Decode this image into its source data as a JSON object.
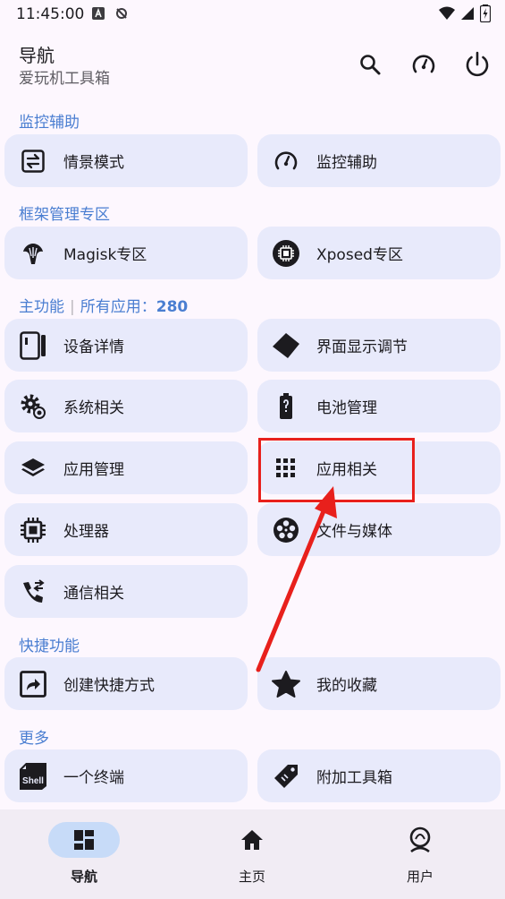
{
  "status_bar": {
    "time": "11:45:00",
    "icons": [
      "a-letter-icon",
      "no-sync-icon",
      "wifi-icon",
      "signal-icon",
      "battery-charging-icon"
    ]
  },
  "header": {
    "title": "导航",
    "subtitle": "爱玩机工具箱",
    "actions": [
      "search-icon",
      "speedometer-icon",
      "power-icon"
    ]
  },
  "sections": {
    "monitor": {
      "label": "监控辅助"
    },
    "framework": {
      "label": "框架管理专区"
    },
    "main": {
      "label": "主功能",
      "apps_label": "所有应用：",
      "apps_count": "280"
    },
    "shortcut": {
      "label": "快捷功能"
    },
    "more": {
      "label": "更多"
    }
  },
  "cards": {
    "scene_mode": "情景模式",
    "monitor_assist": "监控辅助",
    "magisk": "Magisk专区",
    "xposed": "Xposed专区",
    "device_info": "设备详情",
    "display_tuning": "界面显示调节",
    "system": "系统相关",
    "battery": "电池管理",
    "app_manage": "应用管理",
    "app_related": "应用相关",
    "processor": "处理器",
    "file_media": "文件与媒体",
    "telecom": "通信相关",
    "create_shortcut": "创建快捷方式",
    "favorites": "我的收藏",
    "terminal": "一个终端",
    "extra_tools": "附加工具箱"
  },
  "bottom_nav": {
    "nav": "导航",
    "home": "主页",
    "user": "用户"
  },
  "colors": {
    "accent": "#4a7ed1",
    "card_bg": "#e8eafb",
    "highlight": "#e8201c",
    "nav_active_pill": "#c7dbf8"
  }
}
